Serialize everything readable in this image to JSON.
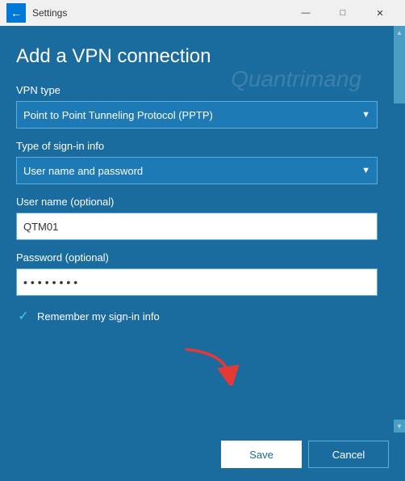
{
  "titlebar": {
    "back_icon": "←",
    "title": "Settings",
    "minimize": "—",
    "maximize": "□",
    "close": "✕"
  },
  "page": {
    "title": "Add a VPN connection",
    "watermark": "Quantrimang"
  },
  "form": {
    "vpn_type_label": "VPN type",
    "vpn_type_value": "Point to Point Tunneling Protocol (PPTP)",
    "signin_type_label": "Type of sign-in info",
    "signin_type_value": "User name and password",
    "username_label": "User name (optional)",
    "username_value": "QTM01",
    "username_placeholder": "",
    "password_label": "Password (optional)",
    "password_value": "••••••••",
    "password_placeholder": "",
    "remember_label": "Remember my sign-in info"
  },
  "footer": {
    "save_label": "Save",
    "cancel_label": "Cancel"
  }
}
